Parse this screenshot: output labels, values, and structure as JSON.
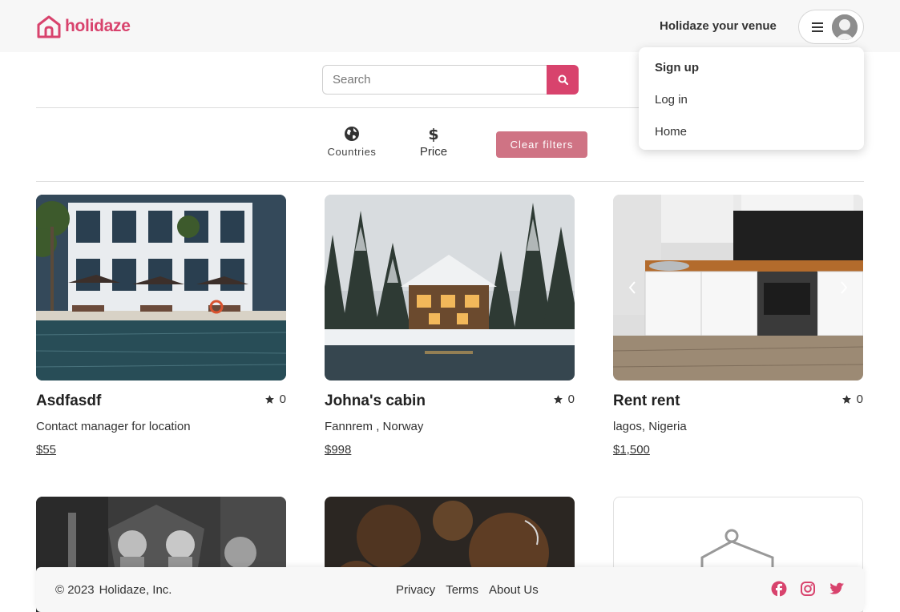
{
  "brand": {
    "name": "holidaze",
    "color": "#d8436d"
  },
  "header": {
    "host_link": "Holidaze your venue",
    "menu_icon": "hamburger-icon",
    "avatar_icon": "user-avatar-icon"
  },
  "search": {
    "placeholder": "Search",
    "value": "",
    "icon": "search-icon"
  },
  "filters": {
    "countries_label": "Countries",
    "price_label": "Price",
    "clear_label": "Clear filters"
  },
  "dropdown": {
    "items": [
      {
        "label": "Sign up"
      },
      {
        "label": "Log in"
      },
      {
        "label": "Home"
      }
    ]
  },
  "venues": [
    {
      "title": "Asdfasdf",
      "rating": "0",
      "location": "Contact manager for location",
      "price": "$55"
    },
    {
      "title": "Johna's cabin",
      "rating": "0",
      "location": "Fannrem , Norway",
      "price": "$998"
    },
    {
      "title": "Rent rent",
      "rating": "0",
      "location": "lagos, Nigeria",
      "price": "$1,500"
    }
  ],
  "footer": {
    "copyright_symbol": "© 2023",
    "company": "Holidaze, Inc.",
    "links": [
      "Privacy",
      "Terms",
      "About Us"
    ],
    "socials": [
      "facebook-icon",
      "instagram-icon",
      "twitter-icon"
    ]
  }
}
